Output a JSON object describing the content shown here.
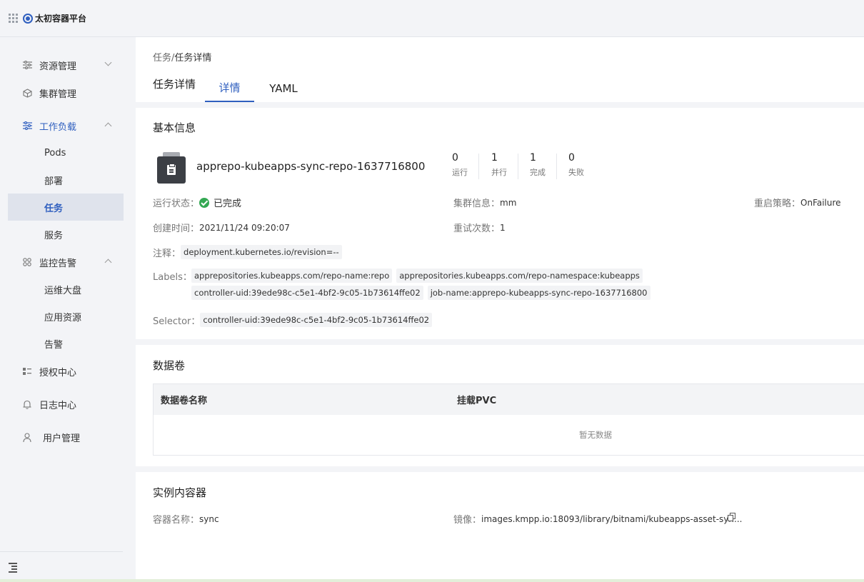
{
  "app": {
    "title": "太初容器平台"
  },
  "sidebar": {
    "items": [
      {
        "label": "资源管理",
        "icon": "sliders-icon"
      },
      {
        "label": "集群管理",
        "icon": "cube-icon"
      },
      {
        "label": "工作负载",
        "icon": "sliders-icon"
      },
      {
        "label": "监控告警",
        "icon": "grid-four-icon"
      },
      {
        "label": "授权中心",
        "icon": "list-icon"
      },
      {
        "label": "日志中心",
        "icon": "bell-icon"
      },
      {
        "label": "用户管理",
        "icon": "user-icon"
      }
    ],
    "workload_children": [
      "Pods",
      "部署",
      "任务",
      "服务"
    ],
    "monitor_children": [
      "运维大盘",
      "应用资源",
      "告警"
    ]
  },
  "breadcrumb": {
    "parent": "任务",
    "sep": "/",
    "current": "任务详情"
  },
  "page": {
    "title": "任务详情",
    "tabs": [
      "详情",
      "YAML"
    ]
  },
  "basic": {
    "title": "基本信息",
    "job_name": "apprepo-kubeapps-sync-repo-1637716800",
    "stats": [
      {
        "value": "0",
        "label": "运行"
      },
      {
        "value": "1",
        "label": "并行"
      },
      {
        "value": "1",
        "label": "完成"
      },
      {
        "value": "0",
        "label": "失败"
      }
    ],
    "run_status_label": "运行状态：",
    "run_status_value": "已完成",
    "cluster_label": "集群信息：",
    "cluster_value": "mm",
    "restart_label": "重启策略：",
    "restart_value": "OnFailure",
    "created_label": "创建时间：",
    "created_value": "2021/11/24 09:20:07",
    "retry_label": "重试次数：",
    "retry_value": "1",
    "annotation_label": "注释：",
    "annotations": [
      "deployment.kubernetes.io/revision=--"
    ],
    "labels_label": "Labels：",
    "labels": [
      "apprepositories.kubeapps.com/repo-name:repo",
      "apprepositories.kubeapps.com/repo-namespace:kubeapps",
      "controller-uid:39ede98c-c5e1-4bf2-9c05-1b73614ffe02",
      "job-name:apprepo-kubeapps-sync-repo-1637716800"
    ],
    "selector_label": "Selector：",
    "selectors": [
      "controller-uid:39ede98c-c5e1-4bf2-9c05-1b73614ffe02"
    ]
  },
  "volumes": {
    "title": "数据卷",
    "columns": [
      "数据卷名称",
      "挂载PVC"
    ],
    "empty": "暂无数据"
  },
  "containers": {
    "title": "实例内容器",
    "name_label": "容器名称：",
    "name_value": "sync",
    "image_label": "镜像：",
    "image_value": "images.kmpp.io:18093/library/bitnami/kubeapps-asset-syn..."
  }
}
